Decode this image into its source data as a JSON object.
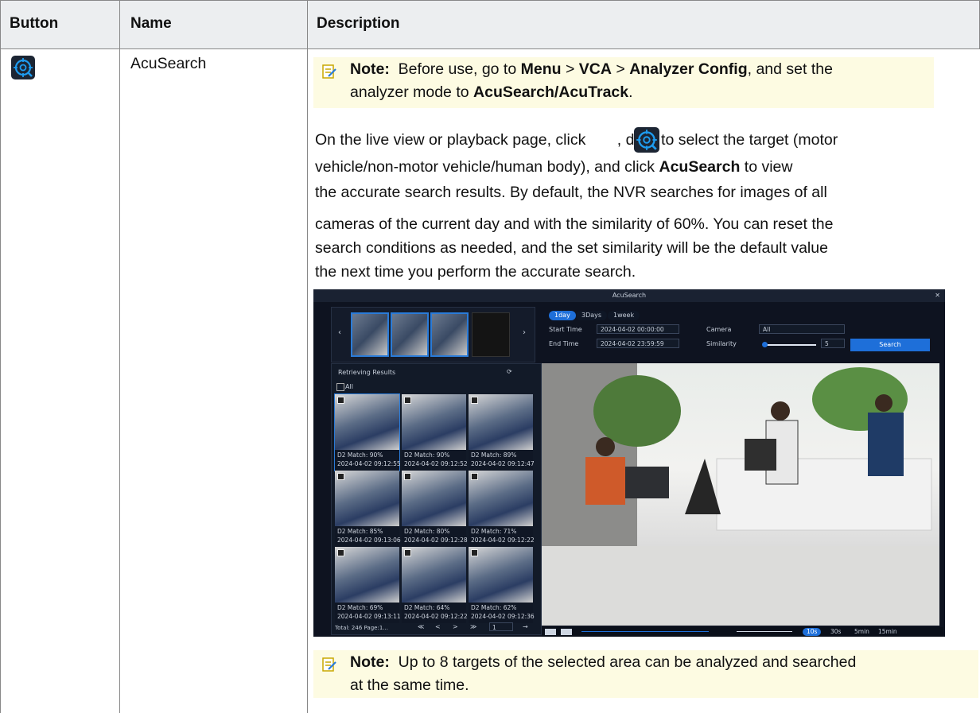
{
  "table": {
    "headers": [
      "Button",
      "Name",
      "Description"
    ],
    "row": {
      "name": "AcuSearch",
      "note1": {
        "label": "Note:",
        "t1": "Before use, go to",
        "menu": "Menu",
        "sep1": ">",
        "vca": "VCA",
        "sep2": ">",
        "analyzer": "Analyzer Config",
        "t2": ", and set the",
        "t3": "analyzer mode to",
        "mode": "AcuSearch/AcuTrack",
        "t4": "."
      },
      "para": {
        "p1a": "On the live view or playback page, click",
        "p1b": ", drag to select the target (motor",
        "p2a": "vehicle/non-motor vehicle/human body), and click",
        "p2b": "AcuSearch",
        "p2c": "to view",
        "l3": "the accurate search results. By default, the NVR searches for images of all",
        "l4": "cameras of the current day and with the similarity of 60%. You can reset the",
        "l5": "search conditions as needed, and the set similarity will be the default value",
        "l6": "the next time you perform the accurate search."
      },
      "note2": {
        "label": "Note:",
        "l1": "Up to 8 targets of the selected area can be analyzed and searched",
        "l2": "at the same time."
      }
    }
  },
  "screenshot": {
    "title": "AcuSearch",
    "tabs": [
      "1day",
      "3Days",
      "1week"
    ],
    "start_label": "Start Time",
    "start_value": "2024-04-02 00:00:00",
    "end_label": "End Time",
    "end_value": "2024-04-02 23:59:59",
    "camera_label": "Camera",
    "camera_value": "All",
    "similarity_label": "Similarity",
    "similarity_value": "5",
    "search_button": "Search",
    "results_label": "Retrieving Results",
    "all_label": "All",
    "results": [
      {
        "match": "D2  Match:  90%",
        "time": "2024-04-02 09:12:55"
      },
      {
        "match": "D2  Match:  90%",
        "time": "2024-04-02 09:12:52"
      },
      {
        "match": "D2  Match:  89%",
        "time": "2024-04-02 09:12:47"
      },
      {
        "match": "D2  Match:  85%",
        "time": "2024-04-02 09:13:06"
      },
      {
        "match": "D2  Match:  80%",
        "time": "2024-04-02 09:12:28"
      },
      {
        "match": "D2  Match:  71%",
        "time": "2024-04-02 09:12:22"
      },
      {
        "match": "D2  Match:  69%",
        "time": "2024-04-02 09:13:11"
      },
      {
        "match": "D2  Match:  64%",
        "time": "2024-04-02 09:12:22"
      },
      {
        "match": "D2  Match:  62%",
        "time": "2024-04-02 09:12:36"
      }
    ],
    "pager_total": "Total: 246  Page:1...",
    "pager_buttons": [
      "≪",
      "<",
      ">",
      "≫"
    ],
    "pager_input": "1",
    "pager_go": "→",
    "time_scales": [
      "10s",
      "30s",
      "5min",
      "15min"
    ],
    "colors": {
      "accent": "#1e6fd9",
      "panel": "#121a28"
    }
  }
}
